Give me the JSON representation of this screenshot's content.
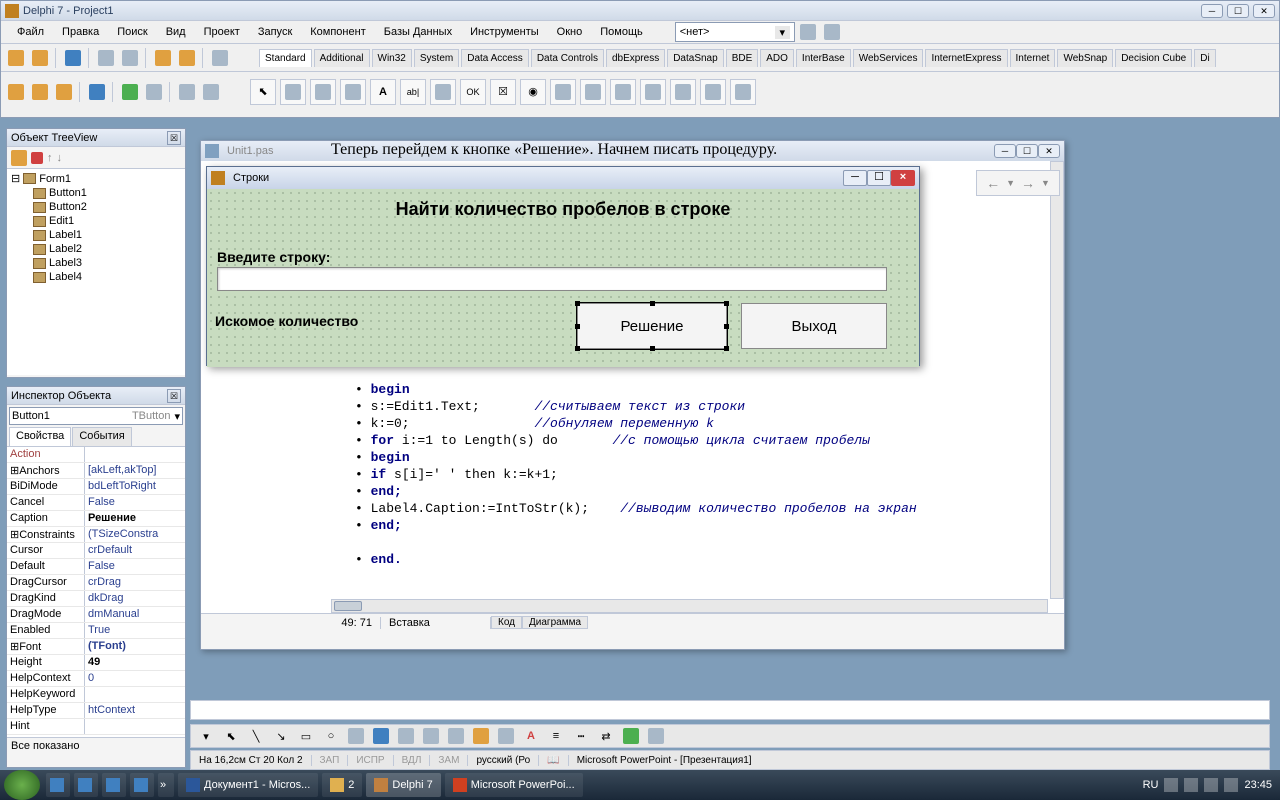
{
  "ide": {
    "title": "Delphi 7 - Project1",
    "menu": [
      "Файл",
      "Правка",
      "Поиск",
      "Вид",
      "Проект",
      "Запуск",
      "Компонент",
      "Базы Данных",
      "Инструменты",
      "Окно",
      "Помощь"
    ],
    "combo_hint": "<нет>",
    "palette_tabs": [
      "Standard",
      "Additional",
      "Win32",
      "System",
      "Data Access",
      "Data Controls",
      "dbExpress",
      "DataSnap",
      "BDE",
      "ADO",
      "InterBase",
      "WebServices",
      "InternetExpress",
      "Internet",
      "WebSnap",
      "Decision Cube",
      "Di"
    ]
  },
  "treeview": {
    "title": "Объект TreeView",
    "root": "Form1",
    "children": [
      "Button1",
      "Button2",
      "Edit1",
      "Label1",
      "Label2",
      "Label3",
      "Label4"
    ]
  },
  "inspector": {
    "title": "Инспектор Объекта",
    "combo_name": "Button1",
    "combo_type": "TButton",
    "tabs": [
      "Свойства",
      "События"
    ],
    "rows": [
      {
        "n": "Action",
        "v": "",
        "cls": "action"
      },
      {
        "n": "⊞Anchors",
        "v": "[akLeft,akTop]",
        "vc": "brace"
      },
      {
        "n": "BiDiMode",
        "v": "bdLeftToRight",
        "vc": "brace"
      },
      {
        "n": "Cancel",
        "v": "False",
        "vc": "brace"
      },
      {
        "n": "Caption",
        "v": "Решение",
        "vc": "bold"
      },
      {
        "n": "⊞Constraints",
        "v": "(TSizeConstra",
        "vc": "brace"
      },
      {
        "n": "Cursor",
        "v": "crDefault",
        "vc": "brace"
      },
      {
        "n": "Default",
        "v": "False",
        "vc": "brace"
      },
      {
        "n": "DragCursor",
        "v": "crDrag",
        "vc": "brace"
      },
      {
        "n": "DragKind",
        "v": "dkDrag",
        "vc": "brace"
      },
      {
        "n": "DragMode",
        "v": "dmManual",
        "vc": "brace"
      },
      {
        "n": "Enabled",
        "v": "True",
        "vc": "brace"
      },
      {
        "n": "⊞Font",
        "v": "(TFont)",
        "vc": "bold brace"
      },
      {
        "n": "Height",
        "v": "49",
        "vc": "bold"
      },
      {
        "n": "HelpContext",
        "v": "0",
        "vc": "brace"
      },
      {
        "n": "HelpKeyword",
        "v": ""
      },
      {
        "n": "HelpType",
        "v": "htContext",
        "vc": "brace"
      },
      {
        "n": "Hint",
        "v": ""
      }
    ],
    "status": "Все показано"
  },
  "code_window": {
    "tab_file": "Unit1.pas",
    "doc_line": "Теперь перейдем к кнопке «Решение». Начнем писать процедуру.",
    "lines": [
      {
        "t": "begin",
        "kw": true
      },
      {
        "t": "s:=Edit1.Text;      ",
        "c": "//считываем текст из строки"
      },
      {
        "t": "k:=0;               ",
        "c": "//обнуляем переменную k"
      },
      {
        "t": "for i:=1 to Length(s) do      ",
        "c": "//с помощью цикла считаем пробелы",
        "kw": "for"
      },
      {
        "t": "begin",
        "kw": true
      },
      {
        "t": "if s[i]=' ' then k:=k+1;",
        "kw": "if"
      },
      {
        "t": "end;",
        "kw": true
      },
      {
        "t": "Label4.Caption:=IntToStr(k);   ",
        "c": "//выводим количество пробелов на экран"
      },
      {
        "t": "end;",
        "kw": true
      },
      {
        "t": ""
      },
      {
        "t": "end.",
        "kw": true
      }
    ],
    "status_pos": "49: 71",
    "status_mode": "Вставка",
    "tabs": [
      "Код",
      "Диаграмма"
    ]
  },
  "form": {
    "title": "Строки",
    "heading": "Найти количество пробелов в строке",
    "label_input": "Введите строку:",
    "label_result": "Искомое количество",
    "btn_solve": "Решение",
    "btn_exit": "Выход"
  },
  "word_status": {
    "pos": "На 16,2см  Ст 20   Кол 2",
    "flags": [
      "ЗАП",
      "ИСПР",
      "ВДЛ",
      "ЗАМ"
    ],
    "lang": "русский (Ро"
  },
  "taskbar": {
    "items": [
      {
        "t": "Документ1 - Micros...",
        "i": "word"
      },
      {
        "t": "2",
        "i": "folder"
      },
      {
        "t": "Delphi 7",
        "i": "delphi",
        "active": true
      },
      {
        "t": "Microsoft PowerPoi...",
        "i": "ppt"
      }
    ],
    "ppt_title": "Microsoft PowerPoint - [Презентация1]",
    "lang": "RU",
    "time": "23:45"
  }
}
